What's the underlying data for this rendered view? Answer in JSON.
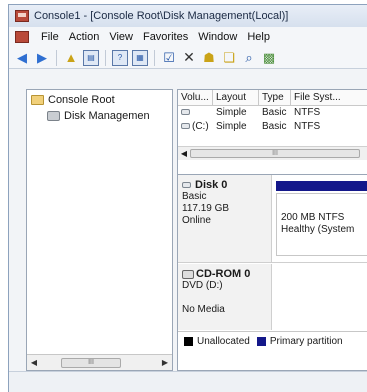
{
  "window": {
    "title": "Console1 - [Console Root\\Disk Management(Local)]"
  },
  "menu": [
    "File",
    "Action",
    "View",
    "Favorites",
    "Window",
    "Help"
  ],
  "tree": {
    "root": "Console Root",
    "child": "Disk Managemen"
  },
  "volumes": {
    "headers": [
      "Volu...",
      "Layout",
      "Type",
      "File Syst..."
    ],
    "rows": [
      [
        "",
        "Simple",
        "Basic",
        "NTFS"
      ],
      [
        "(C:)",
        "Simple",
        "Basic",
        "NTFS"
      ]
    ]
  },
  "disks": [
    {
      "name": "Disk 0",
      "type": "Basic",
      "size": "117.19 GB",
      "status": "Online",
      "partition_line1": "200 MB NTFS",
      "partition_line2": "Healthy (System"
    },
    {
      "name": "CD-ROM 0",
      "type": "DVD (D:)",
      "status": "No Media"
    }
  ],
  "legend": {
    "unallocated": "Unallocated",
    "primary": "Primary partition"
  },
  "colors": {
    "unallocated": "#000000",
    "primary": "#14188a"
  },
  "scroll_glyph": "III"
}
